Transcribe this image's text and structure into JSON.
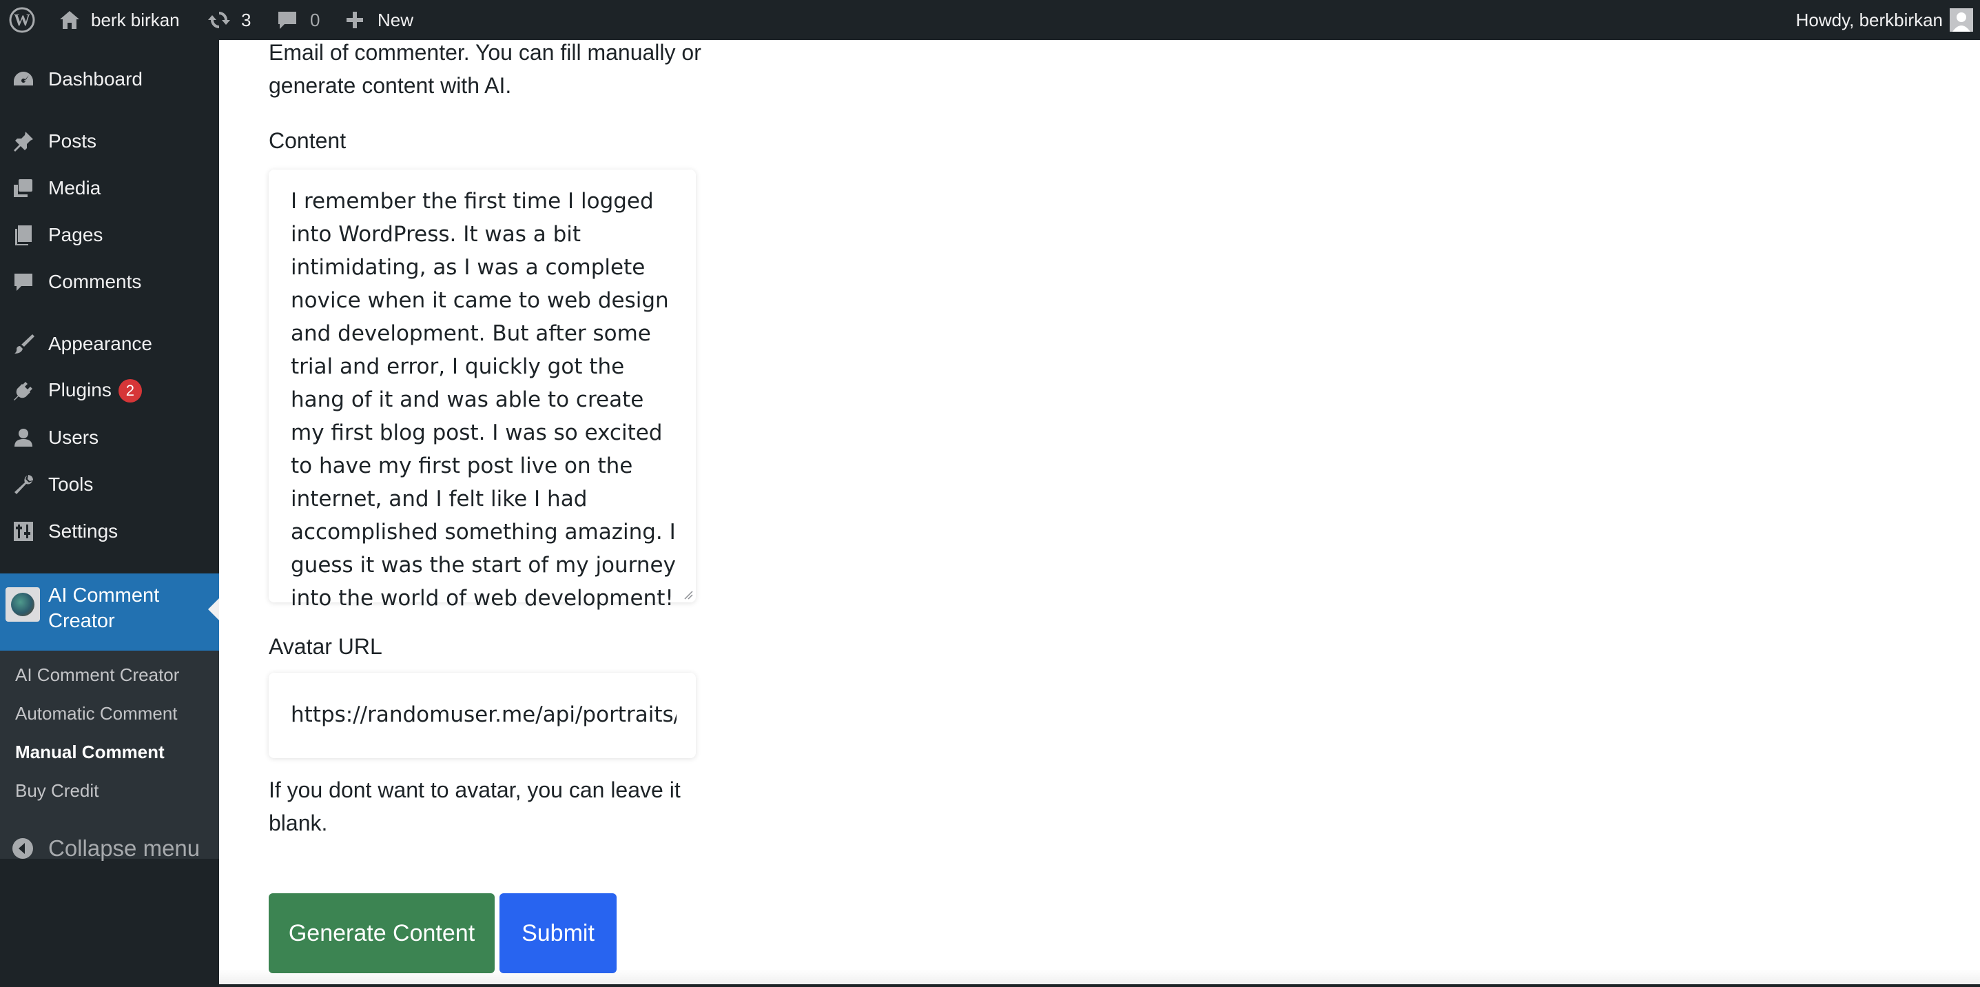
{
  "adminbar": {
    "site_name": "berk birkan",
    "updates_count": "3",
    "comments_count": "0",
    "new_label": "New",
    "howdy": "Howdy, berkbirkan"
  },
  "sidebar": {
    "items": [
      {
        "label": "Dashboard",
        "icon": "dashboard-icon"
      },
      {
        "label": "Posts",
        "icon": "pin-icon"
      },
      {
        "label": "Media",
        "icon": "media-icon"
      },
      {
        "label": "Pages",
        "icon": "pages-icon"
      },
      {
        "label": "Comments",
        "icon": "comment-icon"
      },
      {
        "label": "Appearance",
        "icon": "brush-icon"
      },
      {
        "label": "Plugins",
        "icon": "plug-icon",
        "badge": "2"
      },
      {
        "label": "Users",
        "icon": "user-icon"
      },
      {
        "label": "Tools",
        "icon": "wrench-icon"
      },
      {
        "label": "Settings",
        "icon": "sliders-icon"
      }
    ],
    "current": {
      "label": "AI Comment Creator"
    },
    "submenu": [
      "AI Comment Creator",
      "Automatic Comment",
      "Manual Comment",
      "Buy Credit"
    ],
    "collapse_label": "Collapse menu"
  },
  "form": {
    "email_help": "Email of commenter. You can fill manually or generate content with AI.",
    "content_label": "Content",
    "content_value": "I remember the first time I logged into WordPress. It was a bit intimidating, as I was a complete novice when it came to web design and development. But after some trial and error, I quickly got the hang of it and was able to create my first blog post. I was so excited to have my first post live on the internet, and I felt like I had accomplished something amazing. I guess it was the start of my journey into the world of web development!",
    "avatar_label": "Avatar URL",
    "avatar_value": "https://randomuser.me/api/portraits/men/",
    "avatar_help": "If you dont want to avatar, you can leave it blank.",
    "generate_label": "Generate Content",
    "submit_label": "Submit"
  },
  "colors": {
    "adminbar_bg": "#1d2327",
    "current_menu_bg": "#2271b1",
    "generate_button": "#3c8452",
    "submit_button": "#2864f0",
    "badge": "#d63638"
  }
}
